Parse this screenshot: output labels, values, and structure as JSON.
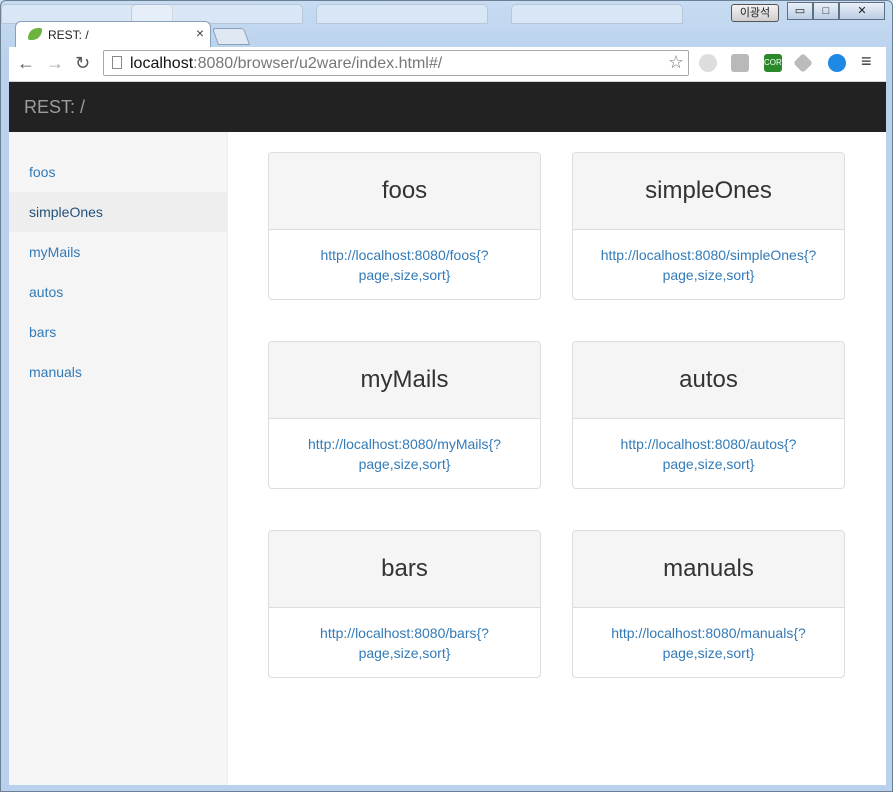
{
  "browser": {
    "tab_title": "REST: /",
    "tab_close": "×",
    "user_name": "이광석",
    "window_buttons": [
      "▭",
      "□",
      "✕"
    ],
    "url_host": "localhost",
    "url_rest": ":8080/browser/u2ware/index.html#/",
    "back": "←",
    "forward": "→",
    "reload": "↻",
    "bookmark_star": "☆",
    "menu": "≡",
    "extension_cors": "CORS"
  },
  "app": {
    "brand": "REST: /",
    "sidebar": [
      {
        "label": "foos"
      },
      {
        "label": "simpleOnes"
      },
      {
        "label": "myMails"
      },
      {
        "label": "autos"
      },
      {
        "label": "bars"
      },
      {
        "label": "manuals"
      }
    ],
    "active_item": "simpleOnes",
    "cards": [
      {
        "title": "foos",
        "link_line1": "http://localhost:8080/foos{?",
        "link_line2": "page,size,sort}"
      },
      {
        "title": "simpleOnes",
        "link_line1": "http://localhost:8080/simpleOnes{?",
        "link_line2": "page,size,sort}"
      },
      {
        "title": "myMails",
        "link_line1": "http://localhost:8080/myMails{?",
        "link_line2": "page,size,sort}"
      },
      {
        "title": "autos",
        "link_line1": "http://localhost:8080/autos{?",
        "link_line2": "page,size,sort}"
      },
      {
        "title": "bars",
        "link_line1": "http://localhost:8080/bars{?",
        "link_line2": "page,size,sort}"
      },
      {
        "title": "manuals",
        "link_line1": "http://localhost:8080/manuals{?",
        "link_line2": "page,size,sort}"
      }
    ]
  },
  "colors": {
    "navbar_bg": "#222222",
    "link": "#337ab7",
    "sidebar_bg": "#f5f5f5",
    "card_head_bg": "#f5f5f5"
  }
}
